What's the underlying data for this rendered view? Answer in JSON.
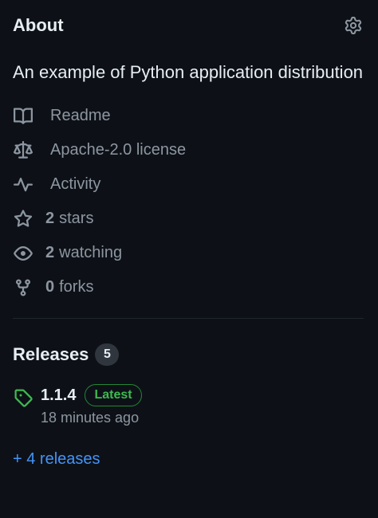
{
  "about": {
    "title": "About",
    "settings_icon": "gear-icon",
    "description": "An example of Python application distribution"
  },
  "meta": [
    {
      "icon": "book-icon",
      "strong": "",
      "label": "Readme"
    },
    {
      "icon": "law-scale-icon",
      "strong": "",
      "label": "Apache-2.0 license"
    },
    {
      "icon": "pulse-icon",
      "strong": "",
      "label": "Activity"
    },
    {
      "icon": "star-icon",
      "strong": "2",
      "label": "stars"
    },
    {
      "icon": "eye-icon",
      "strong": "2",
      "label": "watching"
    },
    {
      "icon": "fork-icon",
      "strong": "0",
      "label": "forks"
    }
  ],
  "releases": {
    "title": "Releases",
    "count": "5",
    "latest": {
      "icon": "tag-icon",
      "name": "1.1.4",
      "badge": "Latest",
      "time": "18 minutes ago"
    },
    "more_link": "+ 4 releases"
  },
  "colors": {
    "background": "#0d1117",
    "text_primary": "#e6edf3",
    "text_muted": "#8d96a0",
    "accent_link": "#4493f8",
    "success": "#3fb950",
    "success_border": "#238636",
    "badge_bg": "#30363d",
    "divider": "#21262d"
  }
}
